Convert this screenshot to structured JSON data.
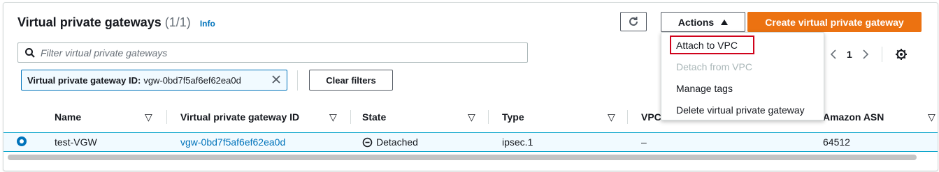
{
  "header": {
    "title": "Virtual private gateways",
    "count": "(1/1)",
    "info": "Info"
  },
  "toolbar": {
    "actions_label": "Actions",
    "create_label": "Create virtual private gateway"
  },
  "search": {
    "placeholder": "Filter virtual private gateways"
  },
  "pagination": {
    "current_page": "1"
  },
  "filter_token": {
    "key": "Virtual private gateway ID:",
    "value": "vgw-0bd7f5af6ef62ea0d"
  },
  "clear_filters_label": "Clear filters",
  "table": {
    "columns": [
      "Name",
      "Virtual private gateway ID",
      "State",
      "Type",
      "VPC",
      "Amazon ASN"
    ],
    "rows": [
      {
        "name": "test-VGW",
        "id": "vgw-0bd7f5af6ef62ea0d",
        "state": "Detached",
        "type": "ipsec.1",
        "vpc": "–",
        "asn": "64512"
      }
    ]
  },
  "actions_menu": {
    "items": [
      {
        "label": "Attach to VPC",
        "disabled": false
      },
      {
        "label": "Detach from VPC",
        "disabled": true
      },
      {
        "label": "Manage tags",
        "disabled": false
      },
      {
        "label": "Delete virtual private gateway",
        "disabled": false
      }
    ]
  },
  "colors": {
    "primary_orange": "#ec7211",
    "link_blue": "#0073bb",
    "selected_row_bg": "#f1faff",
    "highlight_red": "#d0021b"
  },
  "icons": {
    "refresh": "refresh-icon",
    "caret_up": "caret-up-icon",
    "search": "search-icon",
    "close": "close-icon",
    "chevron_left": "chevron-left-icon",
    "chevron_right": "chevron-right-icon",
    "settings": "gear-icon",
    "sort": "sort-down-icon",
    "state_detached": "minus-circle-icon"
  }
}
